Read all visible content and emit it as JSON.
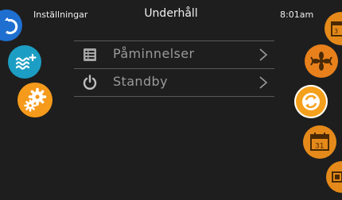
{
  "header": {
    "left_label": "Inställningar",
    "title": "Underhåll",
    "time": "8:01am"
  },
  "menu": {
    "items": [
      {
        "label": "Påminnelser",
        "icon": "list-icon"
      },
      {
        "label": "Standby",
        "icon": "power-icon"
      }
    ]
  },
  "left_bar": [
    {
      "name": "partial-blue-icon",
      "color": "#1f6fd0"
    },
    {
      "name": "water-heat-icon",
      "color": "#1c9ec4"
    },
    {
      "name": "settings-gears-icon",
      "color": "#f59a1b"
    }
  ],
  "right_bar": [
    {
      "name": "calendar-partial-icon",
      "color": "#e58a1a"
    },
    {
      "name": "fan-icon",
      "color": "#e8801c"
    },
    {
      "name": "cycle-icon",
      "color": "#f4a01c"
    },
    {
      "name": "calendar-31-icon",
      "color": "#e58a1a",
      "label": "31"
    },
    {
      "name": "partial-orange-icon",
      "color": "#e58a1a"
    }
  ]
}
